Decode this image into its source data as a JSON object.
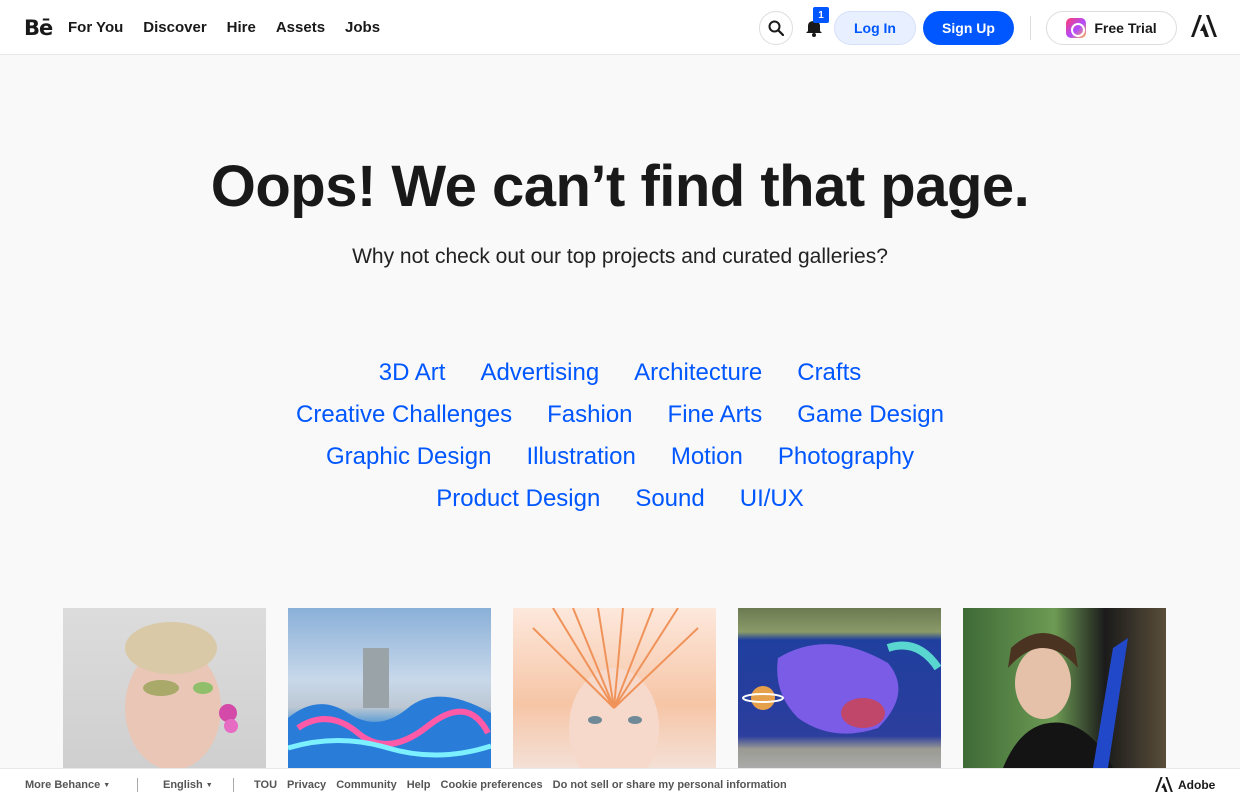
{
  "header": {
    "logo": "Bē",
    "nav": [
      "For You",
      "Discover",
      "Hire",
      "Assets",
      "Jobs"
    ],
    "notification_count": "1",
    "login_label": "Log In",
    "signup_label": "Sign Up",
    "trial_label": "Free Trial"
  },
  "hero": {
    "title": "Oops! We can’t find that page.",
    "subtitle": "Why not check out our top projects and curated galleries?"
  },
  "categories": [
    [
      "3D Art",
      "Advertising",
      "Architecture",
      "Crafts"
    ],
    [
      "Creative Challenges",
      "Fashion",
      "Fine Arts",
      "Game Design"
    ],
    [
      "Graphic Design",
      "Illustration",
      "Motion",
      "Photography"
    ],
    [
      "Product Design",
      "Sound",
      "UI/UX"
    ]
  ],
  "thumbnails": [
    "makeup-portrait",
    "graffiti-wall",
    "straw-hair-portrait",
    "mural-creature",
    "forest-portrait"
  ],
  "footer": {
    "more_label": "More Behance",
    "language_label": "English",
    "links": [
      "TOU",
      "Privacy",
      "Community",
      "Help",
      "Cookie preferences",
      "Do not sell or share my personal information"
    ],
    "adobe_label": "Adobe"
  },
  "colors": {
    "accent": "#0057ff",
    "text": "#191919",
    "background": "#f9f9f9"
  }
}
